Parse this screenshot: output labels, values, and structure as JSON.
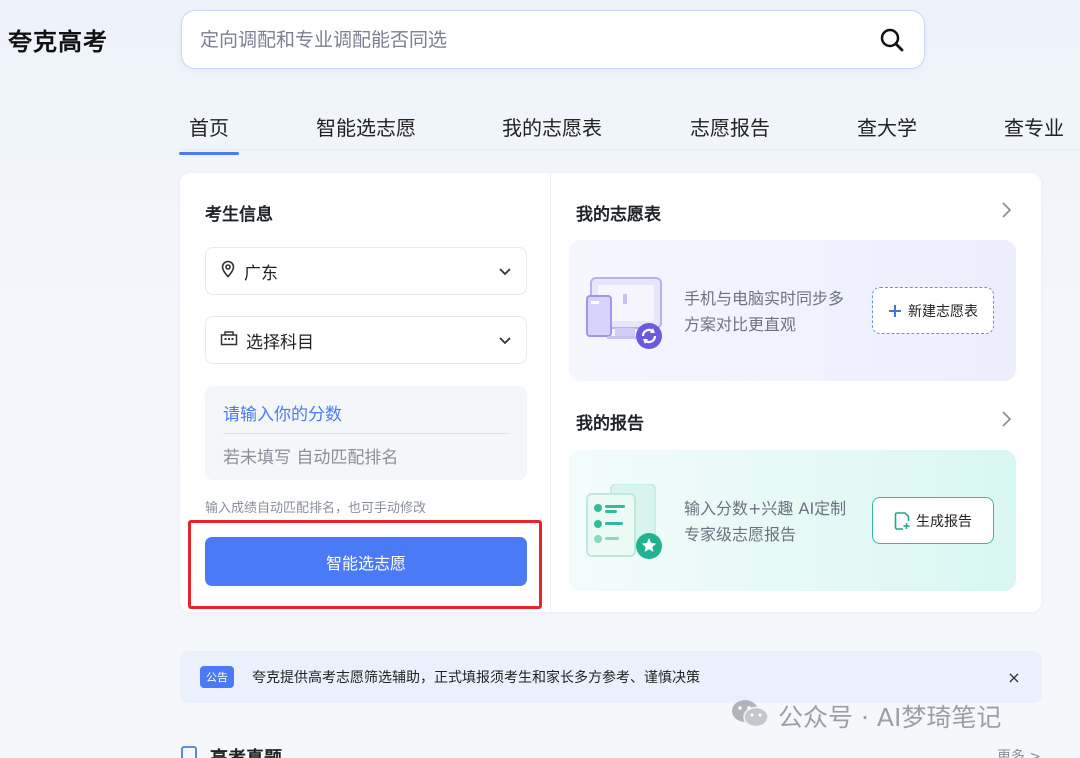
{
  "brand": {
    "logo": "夸克高考"
  },
  "search": {
    "placeholder": "定向调配和专业调配能否同选"
  },
  "nav": {
    "tabs": [
      {
        "label": "首页",
        "active": true
      },
      {
        "label": "智能选志愿"
      },
      {
        "label": "我的志愿表"
      },
      {
        "label": "志愿报告"
      },
      {
        "label": "查大学"
      },
      {
        "label": "查专业"
      }
    ]
  },
  "candidate": {
    "title": "考生信息",
    "province": "广东",
    "subjects": "选择科目",
    "score_placeholder": "请输入你的分数",
    "rank_placeholder": "若未填写 自动匹配排名",
    "hint": "输入成绩自动匹配排名，也可手动修改",
    "submit_label": "智能选志愿"
  },
  "my_table": {
    "title": "我的志愿表",
    "desc": "手机与电脑实时同步多方案对比更直观",
    "button": "新建志愿表"
  },
  "my_report": {
    "title": "我的报告",
    "desc": "输入分数+兴趣 AI定制专家级志愿报告",
    "button": "生成报告"
  },
  "notice": {
    "badge": "公告",
    "text": "夸克提供高考志愿筛选辅助，正式填报须考生和家长多方参考、谨慎决策",
    "close": "×"
  },
  "watermark": {
    "text": "公众号 · AI梦琦笔记"
  },
  "bottom": {
    "title": "高考真题",
    "more": "更多 >"
  },
  "colors": {
    "primary": "#4a7af5",
    "highlight": "#e8232a",
    "teal": "#3bb8a3"
  }
}
